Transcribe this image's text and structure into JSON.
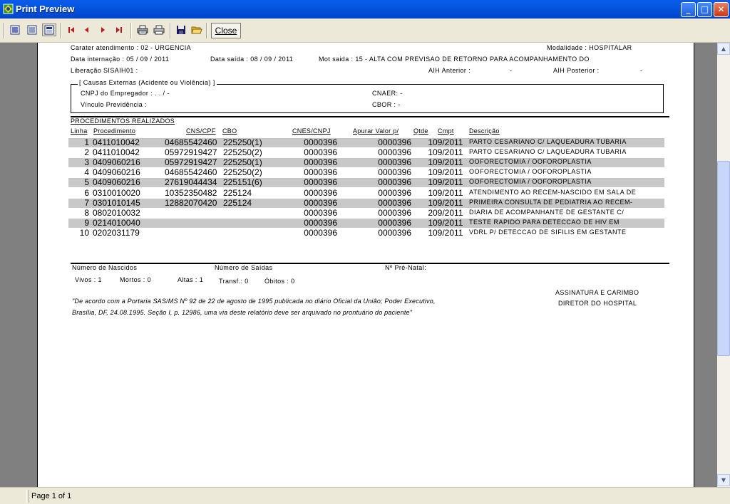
{
  "window": {
    "title": "Print Preview",
    "minimize": "_",
    "maximize": "□",
    "close": "✕"
  },
  "toolbar": {
    "close_label": "Close"
  },
  "status": {
    "page": "Page 1 of 1"
  },
  "report": {
    "carater": "Carater atendimento : 02 - URGENCIA",
    "modalidade": "Modalidade : HOSPITALAR",
    "data_internacao": "Data internação : 05 / 09 / 2011",
    "data_saida": "Data saída : 08 / 09 / 2011",
    "mot_saida": "Mot saida : 15 - ALTA COM PREVISAO DE RETORNO PARA ACOMPANHAMENTO DO",
    "liberacao": "Liberação SISAIH01 :",
    "aih_anterior": "AIH Anterior :",
    "aih_anterior_val": "-",
    "aih_posterior": "AIH Posterior :",
    "aih_posterior_val": "-",
    "causas_title": "[ Causas Externas (Acidente ou Violência) ]",
    "cnpj": "CNPJ do Empregador :   .   .   /   -",
    "cnaer": "CNAER:  -",
    "vinculo": "Vínculo Previdência :",
    "cbor": "CBOR :  -",
    "proc_title": "PROCEDIMENTOS REALIZADOS",
    "headers": {
      "linha": "Linha",
      "procedimento": "Procedimento",
      "cns": "CNS/CPF",
      "cbo": "CBO",
      "cnes": "CNES/CNPJ",
      "apurar": "Apurar Valor p/",
      "qtde": "Qtde",
      "cmpt": "Cmpt",
      "descricao": "Descrição"
    },
    "rows": [
      {
        "linha": "1",
        "proc": "0411010042",
        "cns": "04685542460",
        "cbo": "225250(1)",
        "cnes": "0000396",
        "apurar": "0000396",
        "qtde": "1",
        "cmpt": "09/2011",
        "desc": "PARTO CESARIANO C/ LAQUEADURA TUBARIA"
      },
      {
        "linha": "2",
        "proc": "0411010042",
        "cns": "05972919427",
        "cbo": "225250(2)",
        "cnes": "0000396",
        "apurar": "0000396",
        "qtde": "1",
        "cmpt": "09/2011",
        "desc": "PARTO CESARIANO C/ LAQUEADURA TUBARIA"
      },
      {
        "linha": "3",
        "proc": "0409060216",
        "cns": "05972919427",
        "cbo": "225250(1)",
        "cnes": "0000396",
        "apurar": "0000396",
        "qtde": "1",
        "cmpt": "09/2011",
        "desc": "OOFORECTOMIA / OOFOROPLASTIA"
      },
      {
        "linha": "4",
        "proc": "0409060216",
        "cns": "04685542460",
        "cbo": "225250(2)",
        "cnes": "0000396",
        "apurar": "0000396",
        "qtde": "1",
        "cmpt": "09/2011",
        "desc": "OOFORECTOMIA / OOFOROPLASTIA"
      },
      {
        "linha": "5",
        "proc": "0409060216",
        "cns": "27619044434",
        "cbo": "225151(6)",
        "cnes": "0000396",
        "apurar": "0000396",
        "qtde": "1",
        "cmpt": "09/2011",
        "desc": "OOFORECTOMIA / OOFOROPLASTIA"
      },
      {
        "linha": "6",
        "proc": "0310010020",
        "cns": "10352350482",
        "cbo": "225124",
        "cnes": "0000396",
        "apurar": "0000396",
        "qtde": "1",
        "cmpt": "09/2011",
        "desc": "ATENDIMENTO AO RECEM-NASCIDO EM SALA DE"
      },
      {
        "linha": "7",
        "proc": "0301010145",
        "cns": "12882070420",
        "cbo": "225124",
        "cnes": "0000396",
        "apurar": "0000396",
        "qtde": "1",
        "cmpt": "09/2011",
        "desc": "PRIMEIRA CONSULTA DE PEDIATRIA AO RECEM-"
      },
      {
        "linha": "8",
        "proc": "0802010032",
        "cns": "",
        "cbo": "",
        "cnes": "0000396",
        "apurar": "0000396",
        "qtde": "2",
        "cmpt": "09/2011",
        "desc": "DIARIA DE ACOMPANHANTE DE GESTANTE C/"
      },
      {
        "linha": "9",
        "proc": "0214010040",
        "cns": "",
        "cbo": "",
        "cnes": "0000396",
        "apurar": "0000396",
        "qtde": "1",
        "cmpt": "09/2011",
        "desc": "TESTE RAPIDO PARA DETECCAO DE HIV EM"
      },
      {
        "linha": "10",
        "proc": "0202031179",
        "cns": "",
        "cbo": "",
        "cnes": "0000396",
        "apurar": "0000396",
        "qtde": "1",
        "cmpt": "09/2011",
        "desc": "VDRL P/ DETECCAO DE SIFILIS EM GESTANTE"
      }
    ],
    "nascidos": "Número de Nascidos",
    "saidas": "Número de Saídas",
    "prenatal": "Nº Pré-Natal:",
    "vivos": "Vivos : 1",
    "mortos": "Mortos : 0",
    "altas": "Altas : 1",
    "transf": "Transf.: 0",
    "obitos": "Óbitos : 0",
    "legal_1": "\"De acordo com a Portaria SAS/MS Nº 92 de 22 de agosto de 1995 publicada no diário Oficial da União; Poder Executivo,",
    "legal_2": "Brasília, DF, 24.08.1995. Seção I, p. 12986, uma via deste relatório deve ser arquivado no prontuário do paciente\"",
    "assinatura": "ASSINATURA E CARIMBO",
    "diretor": "DIRETOR DO HOSPITAL"
  }
}
